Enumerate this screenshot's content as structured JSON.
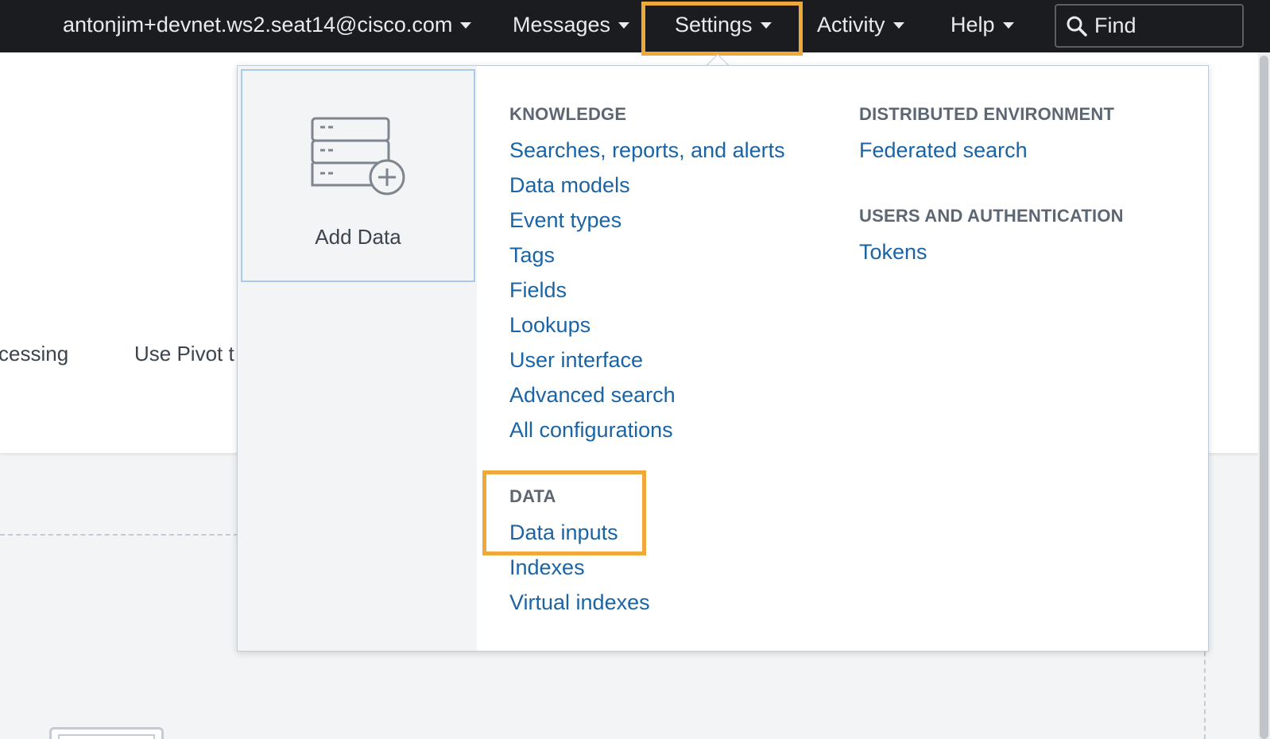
{
  "nav": {
    "account": "antonjim+devnet.ws2.seat14@cisco.com",
    "messages": "Messages",
    "settings": "Settings",
    "activity": "Activity",
    "help": "Help",
    "find_placeholder": "Find"
  },
  "background": {
    "text_processing": "cessing",
    "text_pivot": "Use Pivot t"
  },
  "dropdown": {
    "add_data_label": "Add Data",
    "knowledge": {
      "title": "KNOWLEDGE",
      "items": [
        "Searches, reports, and alerts",
        "Data models",
        "Event types",
        "Tags",
        "Fields",
        "Lookups",
        "User interface",
        "Advanced search",
        "All configurations"
      ]
    },
    "data": {
      "title": "DATA",
      "items": [
        "Data inputs",
        "Indexes",
        "Virtual indexes"
      ]
    },
    "distributed": {
      "title": "DISTRIBUTED ENVIRONMENT",
      "items": [
        "Federated search"
      ]
    },
    "users": {
      "title": "USERS AND AUTHENTICATION",
      "items": [
        "Tokens"
      ]
    }
  },
  "colors": {
    "highlight": "#efa83a",
    "link": "#1a64a6",
    "topbar": "#1a1c20"
  }
}
